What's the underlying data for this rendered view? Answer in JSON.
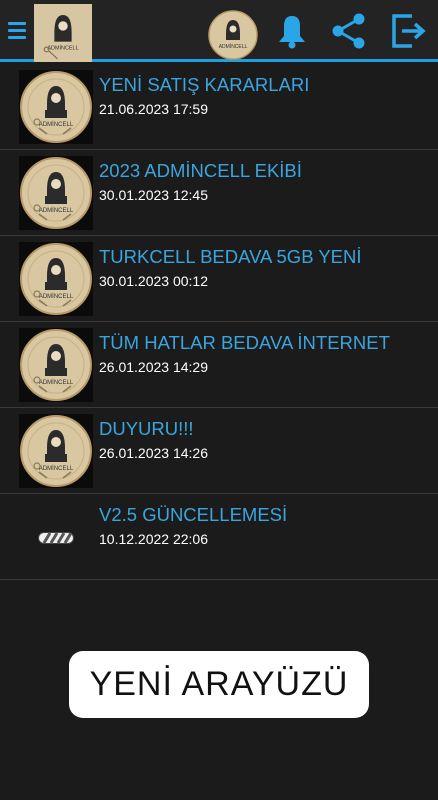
{
  "header": {
    "icons": [
      "menu-icon",
      "app-logo",
      "profile-avatar",
      "bell-icon",
      "share-icon",
      "logout-icon"
    ],
    "accent_color": "#1ea0e0",
    "logo_text": "ADMİNCELL"
  },
  "posts": [
    {
      "title": "YENİ SATIŞ KARARLARI",
      "date": "21.06.2023 17:59",
      "thumb": "admincell-logo"
    },
    {
      "title": "2023 ADMİNCELL EKİBİ",
      "date": "30.01.2023 12:45",
      "thumb": "admincell-logo"
    },
    {
      "title": "TURKCELL BEDAVA 5GB YENİ",
      "date": "30.01.2023 00:12",
      "thumb": "admincell-logo"
    },
    {
      "title": "TÜM HATLAR BEDAVA İNTERNET",
      "date": "26.01.2023 14:29",
      "thumb": "admincell-logo"
    },
    {
      "title": "DUYURU!!!",
      "date": "26.01.2023 14:26",
      "thumb": "admincell-logo"
    },
    {
      "title": "V2.5 GÜNCELLEMESİ",
      "date": "10.12.2022 22:06",
      "thumb": "loading-placeholder"
    }
  ],
  "footer": {
    "button_label": "YENİ ARAYÜZÜ"
  }
}
